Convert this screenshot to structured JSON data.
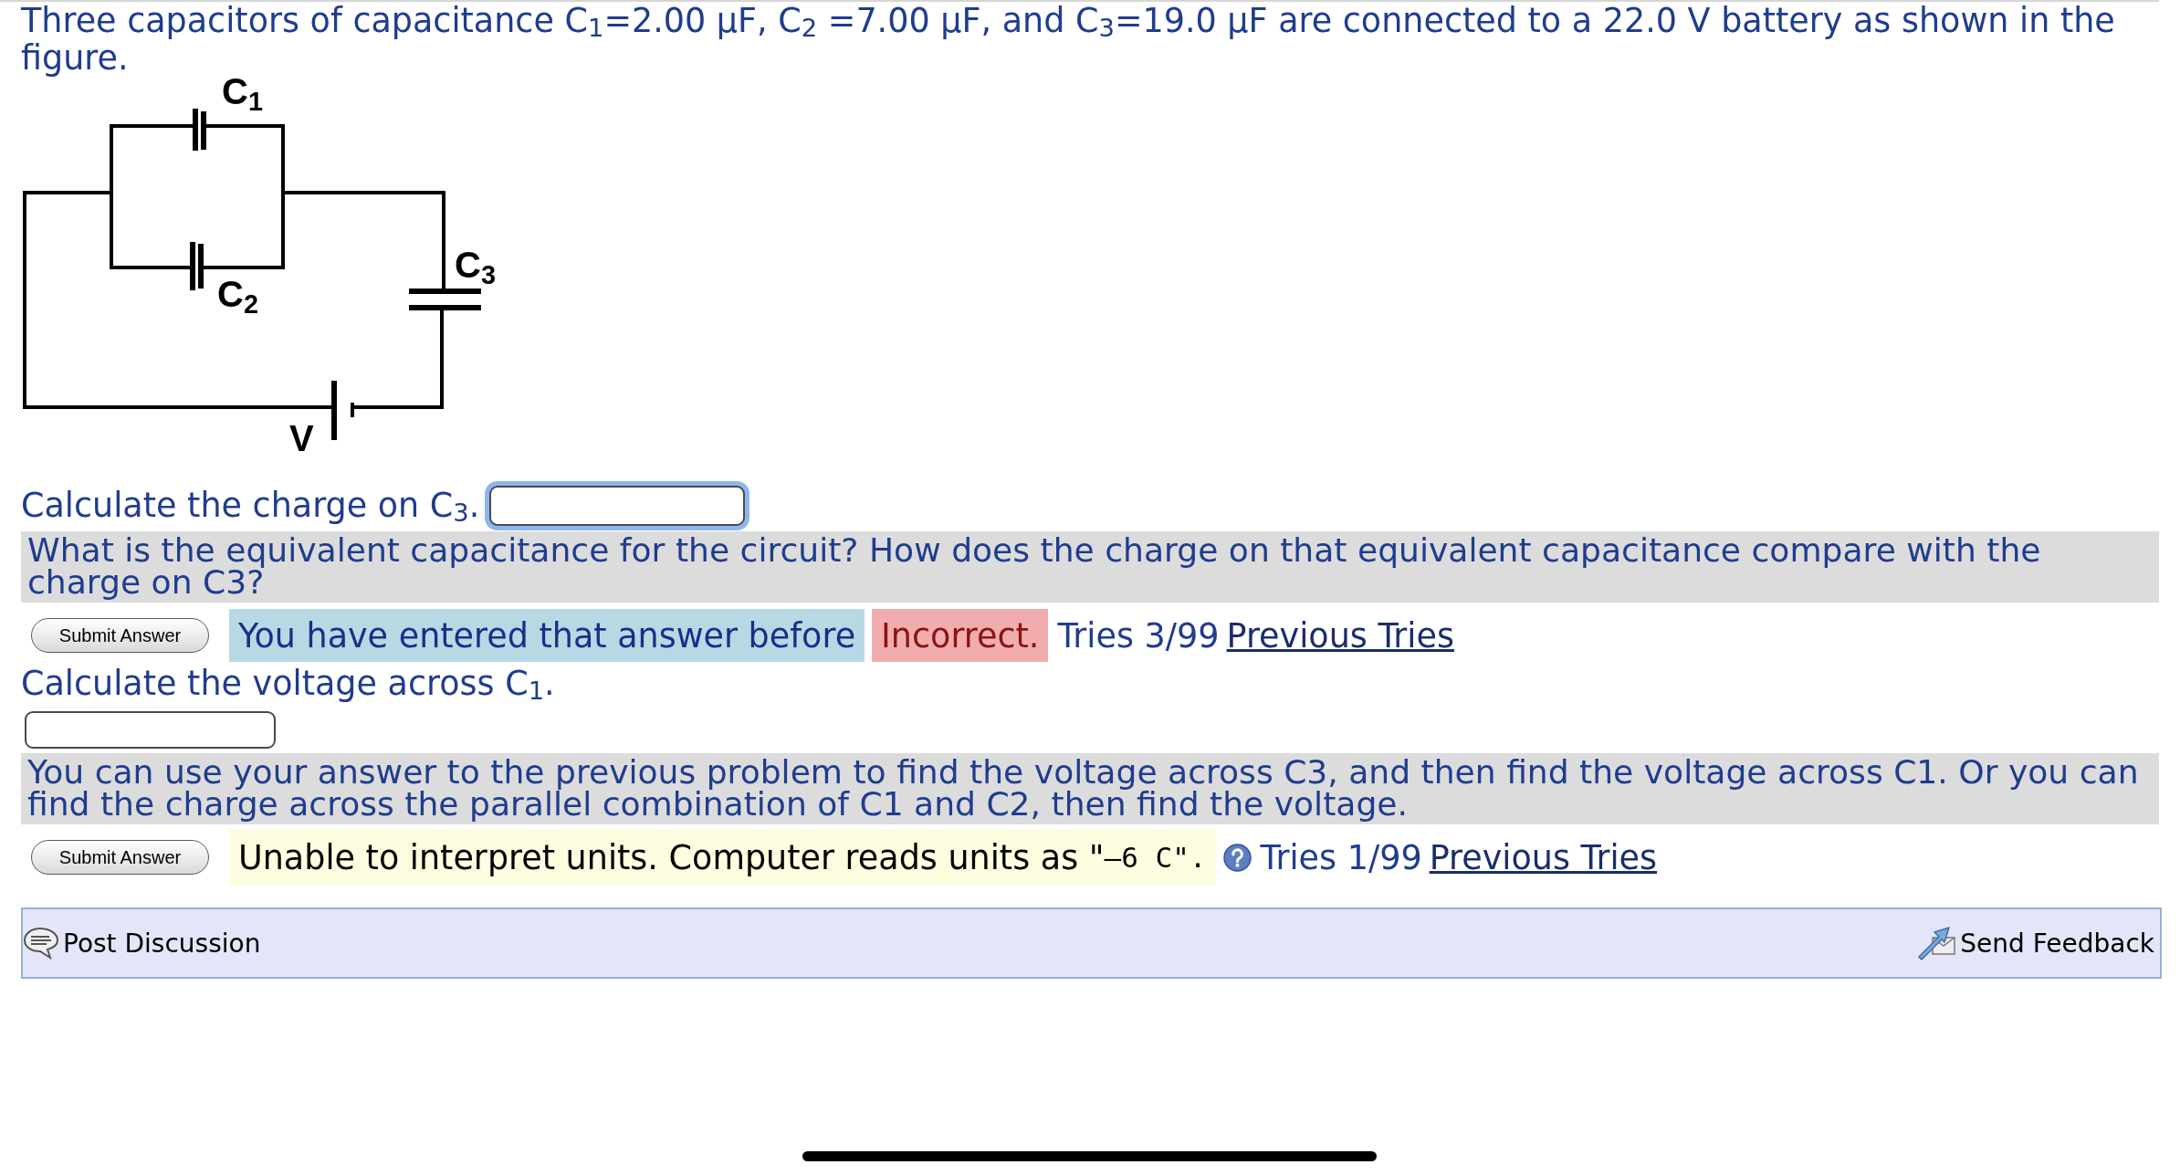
{
  "problem": {
    "text": "Three capacitors of capacitance C$_{1}$=2.00 μF, C$_{2}$ =7.00 μF, and C$_{3}$=19.0 μF are connected to a 22.0 V battery as shown in the figure."
  },
  "figure": {
    "labels": [
      "C$_{1}$",
      "C$_{2}$",
      "C$_{3}$",
      "V"
    ]
  },
  "parts": [
    {
      "kind": "inline_field",
      "prompt": "Calculate the charge on C$_{3}$.",
      "answer_field": {
        "focused": true
      },
      "hint": "What is the equivalent capacitance for the circuit? How does the charge on that equivalent capacitance compare with the charge on C3?",
      "submit_label": "Submit Answer",
      "feedback": [
        {
          "kind": "notice",
          "text": "You have entered that answer before"
        },
        {
          "kind": "incorrect",
          "text": "Incorrect."
        }
      ],
      "tries": "Tries 3/99",
      "previous_tries": "Previous Tries"
    },
    {
      "kind": "field_below",
      "prompt": "Calculate the voltage across C$_{1}$.",
      "answer_field": {
        "focused": false
      },
      "hint": "You can use your answer to the previous problem to find the voltage across C3, and then find the voltage across C1. Or you can find the charge across the parallel combination of C1 and C2, then find the voltage.",
      "submit_label": "Submit Answer",
      "feedback": [
        {
          "kind": "units",
          "text": "Unable to interpret units. Computer reads units as \"",
          "code": "–6 C\"."
        }
      ],
      "help": true,
      "tries": "Tries 1/99",
      "previous_tries": "Previous Tries"
    }
  ],
  "footer": {
    "post_discussion": "Post Discussion",
    "send_feedback": "Send Feedback"
  }
}
